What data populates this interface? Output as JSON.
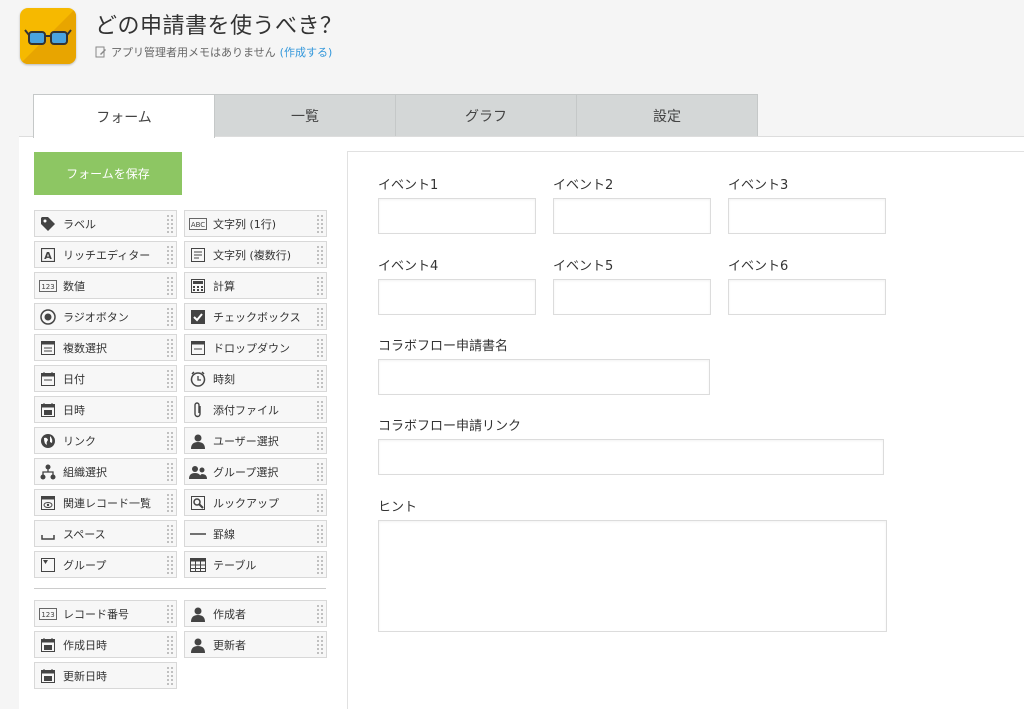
{
  "app": {
    "title": "どの申請書を使うべき？",
    "memo_text": "アプリ管理者用メモはありません",
    "memo_link": "(作成する)"
  },
  "tabs": [
    {
      "label": "フォーム",
      "active": true
    },
    {
      "label": "一覧",
      "active": false
    },
    {
      "label": "グラフ",
      "active": false
    },
    {
      "label": "設定",
      "active": false
    }
  ],
  "palette": {
    "save_label": "フォームを保存",
    "items": [
      {
        "label": "ラベル",
        "icon": "tag-icon"
      },
      {
        "label": "文字列 (1行)",
        "icon": "abc-text-icon"
      },
      {
        "label": "リッチエディター",
        "icon": "rich-editor-icon"
      },
      {
        "label": "文字列 (複数行)",
        "icon": "multiline-text-icon"
      },
      {
        "label": "数値",
        "icon": "number-icon"
      },
      {
        "label": "計算",
        "icon": "calculator-icon"
      },
      {
        "label": "ラジオボタン",
        "icon": "radio-icon"
      },
      {
        "label": "チェックボックス",
        "icon": "checkbox-icon"
      },
      {
        "label": "複数選択",
        "icon": "multi-select-icon"
      },
      {
        "label": "ドロップダウン",
        "icon": "dropdown-icon"
      },
      {
        "label": "日付",
        "icon": "calendar-icon"
      },
      {
        "label": "時刻",
        "icon": "clock-icon"
      },
      {
        "label": "日時",
        "icon": "datetime-icon"
      },
      {
        "label": "添付ファイル",
        "icon": "paperclip-icon"
      },
      {
        "label": "リンク",
        "icon": "globe-icon"
      },
      {
        "label": "ユーザー選択",
        "icon": "user-icon"
      },
      {
        "label": "組織選択",
        "icon": "org-icon"
      },
      {
        "label": "グループ選択",
        "icon": "group-icon"
      },
      {
        "label": "関連レコード一覧",
        "icon": "related-records-icon"
      },
      {
        "label": "ルックアップ",
        "icon": "lookup-icon"
      },
      {
        "label": "スペース",
        "icon": "space-icon"
      },
      {
        "label": "罫線",
        "icon": "line-icon"
      },
      {
        "label": "グループ",
        "icon": "group-field-icon"
      },
      {
        "label": "テーブル",
        "icon": "table-icon"
      }
    ],
    "system_items": [
      {
        "label": "レコード番号",
        "icon": "number-icon"
      },
      {
        "label": "作成者",
        "icon": "user-icon"
      },
      {
        "label": "作成日時",
        "icon": "datetime-icon"
      },
      {
        "label": "更新者",
        "icon": "user-icon"
      },
      {
        "label": "更新日時",
        "icon": "datetime-icon"
      }
    ]
  },
  "form": {
    "event1": "イベント1",
    "event2": "イベント2",
    "event3": "イベント3",
    "event4": "イベント4",
    "event5": "イベント5",
    "event6": "イベント6",
    "collab_name": "コラボフロー申請書名",
    "collab_link": "コラボフロー申請リンク",
    "hint": "ヒント"
  }
}
